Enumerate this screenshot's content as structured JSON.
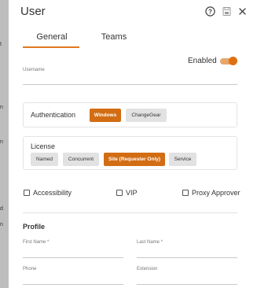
{
  "dialog": {
    "title": "User",
    "header_icons": [
      "help-icon",
      "save-icon",
      "close-icon"
    ]
  },
  "tabs": [
    {
      "label": "General",
      "active": true
    },
    {
      "label": "Teams",
      "active": false
    }
  ],
  "enabled": {
    "label": "Enabled",
    "value": true
  },
  "username": {
    "label": "Username",
    "value": ""
  },
  "authentication": {
    "label": "Authentication",
    "options": [
      {
        "label": "Windows",
        "selected": true
      },
      {
        "label": "ChangeGear",
        "selected": false
      }
    ]
  },
  "license": {
    "label": "License",
    "options": [
      {
        "label": "Named",
        "selected": false
      },
      {
        "label": "Concurrent",
        "selected": false
      },
      {
        "label": "Site (Requester Only)",
        "selected": true
      },
      {
        "label": "Service",
        "selected": false
      }
    ]
  },
  "checkboxes": [
    {
      "label": "Accessibility",
      "checked": false
    },
    {
      "label": "VIP",
      "checked": false
    },
    {
      "label": "Proxy Approver",
      "checked": false
    }
  ],
  "profile": {
    "title": "Profile",
    "first_name": {
      "label": "First Name *",
      "value": ""
    },
    "last_name": {
      "label": "Last Name *",
      "value": ""
    },
    "phone": {
      "label": "Phone",
      "value": ""
    },
    "extension": {
      "label": "Extension",
      "value": ""
    }
  },
  "background_edge": [
    "t",
    "n",
    "n",
    "d",
    "n"
  ],
  "colors": {
    "accent": "#d26d13",
    "toggle_track": "#e7a66a",
    "chip_inactive": "#e2e2e2",
    "backdrop": "#bdbdbd"
  }
}
